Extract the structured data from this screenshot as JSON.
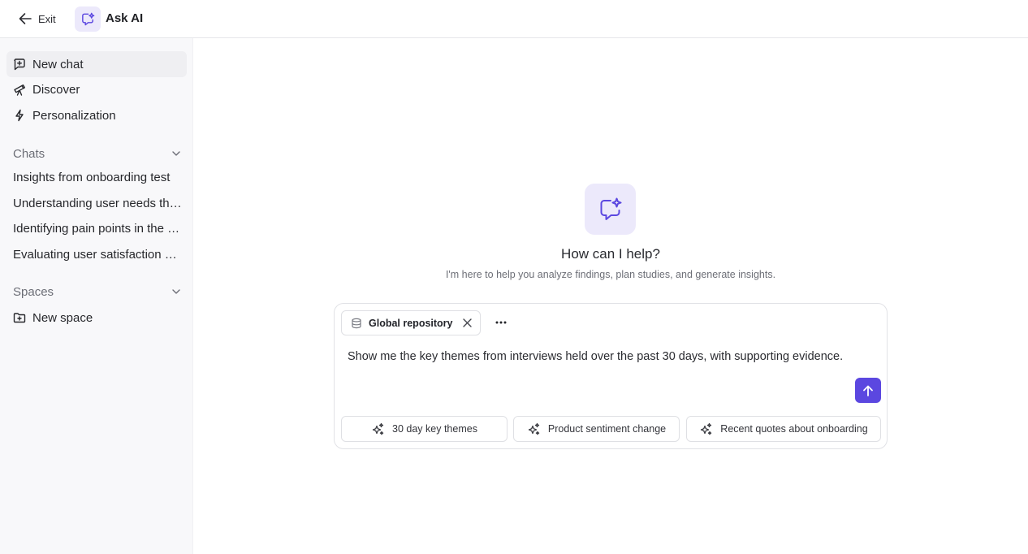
{
  "header": {
    "exit_label": "Exit",
    "app_title": "Ask AI"
  },
  "sidebar": {
    "nav": [
      {
        "label": "New chat",
        "icon": "message-plus-icon",
        "active": true
      },
      {
        "label": "Discover",
        "icon": "telescope-icon"
      },
      {
        "label": "Personalization",
        "icon": "lightning-icon"
      }
    ],
    "chats_title": "Chats",
    "chats": [
      "Insights from onboarding test",
      "Understanding user needs through interviews",
      "Identifying pain points in the checkout flow",
      "Evaluating user satisfaction with new features"
    ],
    "spaces_title": "Spaces",
    "new_space_label": "New space"
  },
  "main": {
    "hero_title": "How can I help?",
    "hero_subtitle": "I'm here to help you analyze findings, plan studies, and generate insights.",
    "composer": {
      "source_chip": "Global repository",
      "prompt": "Show me the key themes from interviews held over the past 30 days, with supporting evidence."
    },
    "suggestions": [
      "30 day key themes",
      "Product sentiment change",
      "Recent quotes about onboarding"
    ]
  },
  "colors": {
    "accent": "#5b47e0",
    "accent_soft": "#ece9fb",
    "sidebar_bg": "#f8f8fa"
  }
}
